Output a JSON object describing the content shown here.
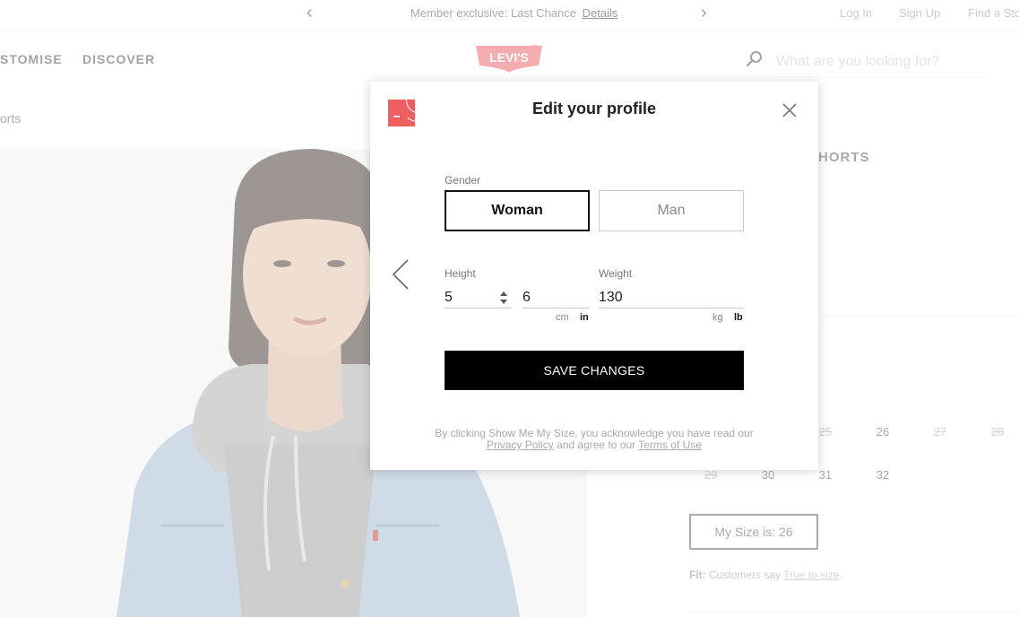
{
  "promo": {
    "text": "Member exclusive: Last Chance",
    "link": "Details",
    "prev_glyph": "‹",
    "next_glyph": "›"
  },
  "utility": {
    "login": "Log In",
    "signup": "Sign Up",
    "find_store": "Find a Sto"
  },
  "nav": {
    "items": [
      "STOMISE",
      "DISCOVER"
    ]
  },
  "brand": {
    "logo_text": "LEVI'S",
    "color": "#e85a5e"
  },
  "search": {
    "placeholder": "What are you looking for?"
  },
  "breadcrumb": "orts",
  "product": {
    "title_fragment": "HORTS"
  },
  "sizes": {
    "row1": [
      {
        "label": "25",
        "available": false
      },
      {
        "label": "26",
        "available": true
      },
      {
        "label": "27",
        "available": false
      },
      {
        "label": "28",
        "available": false
      }
    ],
    "row2": [
      {
        "label": "29",
        "available": false
      },
      {
        "label": "30",
        "available": true
      },
      {
        "label": "31",
        "available": true
      },
      {
        "label": "32",
        "available": true
      }
    ]
  },
  "my_size": "My Size is: 26",
  "fit": {
    "label": "Fit:",
    "text": "Customers say",
    "link": "True to size",
    "end": "."
  },
  "modal": {
    "title": "Edit your profile",
    "gender_label": "Gender",
    "gender_options": [
      "Woman",
      "Man"
    ],
    "gender_selected": "Woman",
    "height_label": "Height",
    "height_feet": "5",
    "height_inches": "6",
    "height_units": [
      "cm",
      "in"
    ],
    "height_unit_selected": "in",
    "weight_label": "Weight",
    "weight_value": "130",
    "weight_units": [
      "kg",
      "lb"
    ],
    "weight_unit_selected": "lb",
    "save_label": "SAVE CHANGES",
    "legal": {
      "prefix": "By clicking Show Me My Size, you acknowledge you have read our",
      "privacy": "Privacy Policy",
      "middle": "and agree to our",
      "terms": "Terms of Use"
    }
  },
  "icons": {
    "close": "close-icon",
    "back": "chevron-left-icon",
    "search": "search-icon",
    "spinner": "stepper-icon",
    "fit_logo": "fit-logo-icon"
  }
}
